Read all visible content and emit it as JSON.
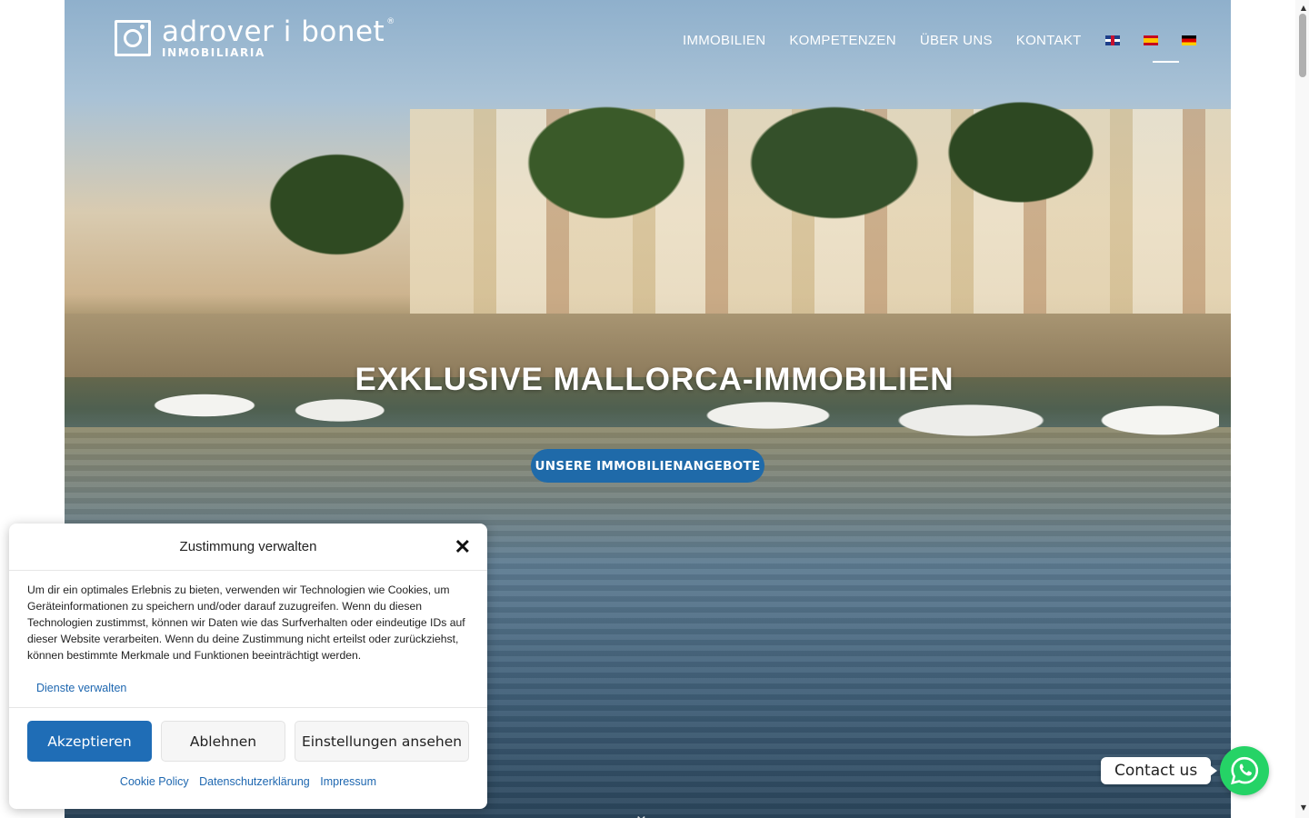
{
  "brand": {
    "name": "adrover i bonet",
    "sub": "INMOBILIARIA",
    "reg": "®"
  },
  "nav": {
    "items": [
      "IMMOBILIEN",
      "KOMPETENZEN",
      "ÜBER UNS",
      "KONTAKT"
    ],
    "languages": [
      "en",
      "es",
      "de"
    ],
    "active_language": "de"
  },
  "hero": {
    "title": "EXKLUSIVE MALLORCA-IMMOBILIEN",
    "cta": "UNSERE IMMOBILIENANGEBOTE"
  },
  "cookie": {
    "title": "Zustimmung verwalten",
    "body": "Um dir ein optimales Erlebnis zu bieten, verwenden wir Technologien wie Cookies, um Geräteinformationen zu speichern und/oder darauf zuzugreifen. Wenn du diesen Technologien zustimmst, können wir Daten wie das Surfverhalten oder eindeutige IDs auf dieser Website verarbeiten. Wenn du deine Zustimmung nicht erteilst oder zurückziehst, können bestimmte Merkmale und Funktionen beeinträchtigt werden.",
    "manage": "Dienste verwalten",
    "accept": "Akzeptieren",
    "deny": "Ablehnen",
    "prefs": "Einstellungen ansehen",
    "links": [
      "Cookie Policy",
      "Datenschutzerklärung",
      "Impressum"
    ]
  },
  "contact": {
    "label": "Contact us"
  },
  "colors": {
    "accent": "#1f6aa9",
    "whatsapp": "#25d366"
  }
}
